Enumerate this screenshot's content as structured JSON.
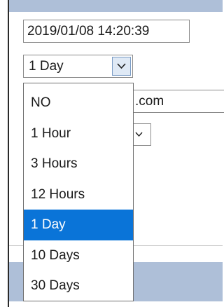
{
  "datetime_field": {
    "value": "2019/01/08 14:20:39"
  },
  "interval_select": {
    "selected": "1 Day",
    "options": [
      "NO",
      "1 Hour",
      "3 Hours",
      "12 Hours",
      "1 Day",
      "10 Days",
      "30 Days"
    ],
    "highlighted_index": 4
  },
  "background_field": {
    "visible_text": ".com"
  },
  "colors": {
    "highlight": "#0a74d8",
    "band": "#aebfd8",
    "button_bg": "#dfe9f5"
  },
  "icons": {
    "dropdown_arrow": "chevron-down-icon",
    "partial_arrow": "chevron-down-icon"
  }
}
